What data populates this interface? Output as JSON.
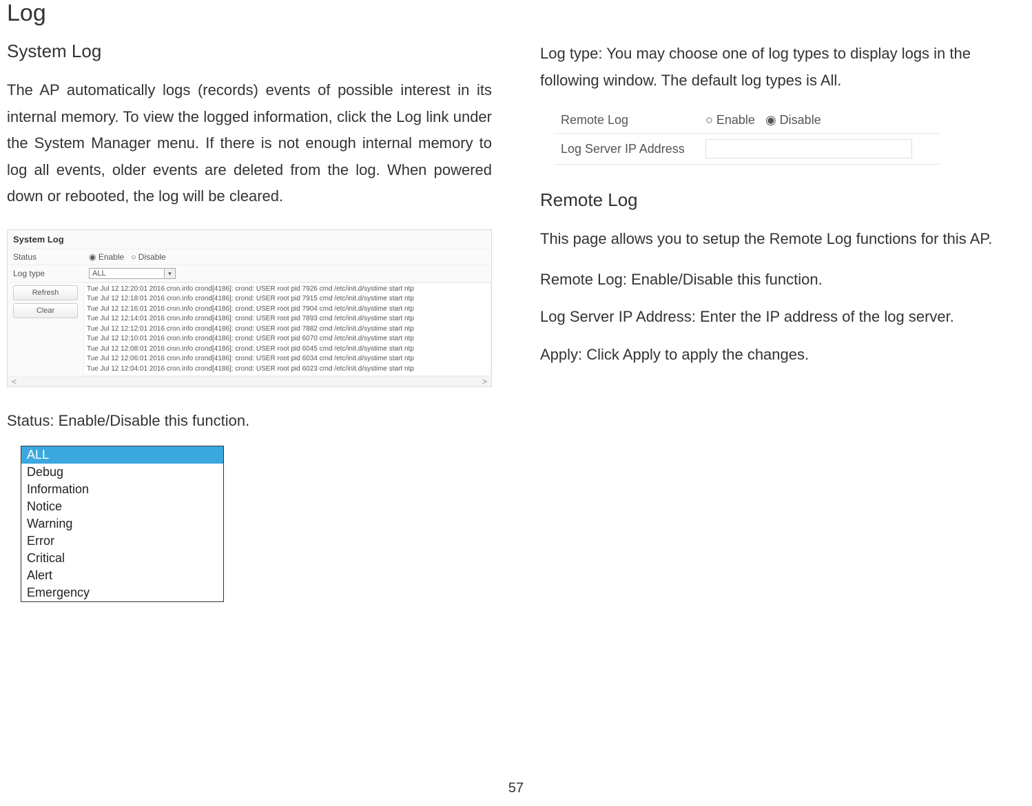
{
  "title": "Log",
  "left": {
    "heading": "System Log",
    "intro": "The AP automatically logs (records) events of possible interest in its internal memory. To view the logged information, click the Log link under the System Manager menu. If there is not enough internal memory to log all events, older events are deleted from the log. When powered down or rebooted, the log will be cleared.",
    "status_line": "Status: Enable/Disable this function.",
    "syslog": {
      "panel_title": "System Log",
      "status_label": "Status",
      "status_enable": "Enable",
      "status_disable": "Disable",
      "logtype_label": "Log type",
      "logtype_value": "ALL",
      "refresh": "Refresh",
      "clear": "Clear",
      "entries": [
        "Tue Jul 12 12:20:01 2016 cron.info crond[4186]: crond: USER root pid 7926 cmd /etc/init.d/systime start ntp",
        "Tue Jul 12 12:18:01 2016 cron.info crond[4186]: crond: USER root pid 7915 cmd /etc/init.d/systime start ntp",
        "Tue Jul 12 12:16:01 2016 cron.info crond[4186]: crond: USER root pid 7904 cmd /etc/init.d/systime start ntp",
        "Tue Jul 12 12:14:01 2016 cron.info crond[4186]: crond: USER root pid 7893 cmd /etc/init.d/systime start ntp",
        "Tue Jul 12 12:12:01 2016 cron.info crond[4186]: crond: USER root pid 7882 cmd /etc/init.d/systime start ntp",
        "Tue Jul 12 12:10:01 2016 cron.info crond[4186]: crond: USER root pid 6070 cmd /etc/init.d/systime start ntp",
        "Tue Jul 12 12:08:01 2016 cron.info crond[4186]: crond: USER root pid 6045 cmd /etc/init.d/systime start ntp",
        "Tue Jul 12 12:06:01 2016 cron.info crond[4186]: crond: USER root pid 6034 cmd /etc/init.d/systime start ntp",
        "Tue Jul 12 12:04:01 2016 cron.info crond[4186]: crond: USER root pid 6023 cmd /etc/init.d/systime start ntp"
      ]
    },
    "logtype_options": [
      "ALL",
      "Debug",
      "Information",
      "Notice",
      "Warning",
      "Error",
      "Critical",
      "Alert",
      "Emergency"
    ]
  },
  "right": {
    "logtype_text_prefix": "Log type",
    "logtype_text_rest": ": You may choose one of log types to display logs in the following window. The default log types is All.",
    "remote_table": {
      "row1_label": "Remote Log",
      "row1_enable": "Enable",
      "row1_disable": "Disable",
      "row2_label": "Log Server IP Address"
    },
    "remote_heading": "Remote Log",
    "remote_intro": "This page allows you to setup the Remote Log functions for this AP.",
    "remote_enable": "Remote Log: Enable/Disable this function.",
    "remote_ip": "Log Server IP Address: Enter the IP address of the log server.",
    "apply": "Apply: Click Apply to apply the changes."
  },
  "page_number": "57"
}
